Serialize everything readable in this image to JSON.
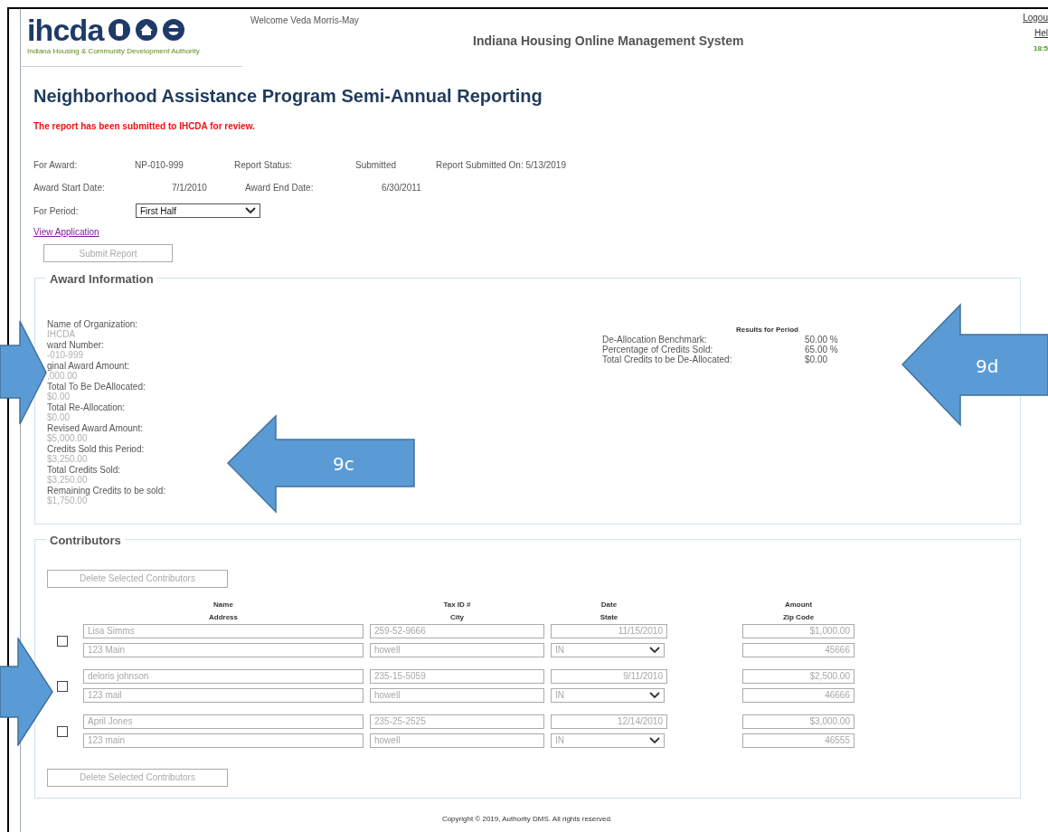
{
  "header": {
    "logo_text": "ihcda",
    "logo_tagline": "Indiana Housing & Community Development Authority",
    "welcome": "Welcome Veda Morris-May",
    "system_title": "Indiana Housing Online Management System",
    "links": [
      "Logou",
      "Hel"
    ],
    "time": "18:5"
  },
  "page_title": "Neighborhood Assistance Program Semi-Annual Reporting",
  "status_message": "The report has been submitted to IHCDA for review.",
  "summary_rows": [
    [
      "For Award:",
      "NP-010-999",
      "Report Status:",
      "Submitted",
      "Report Submitted On: 5/13/2019"
    ],
    [
      "Award Start Date:",
      "7/1/2010",
      "Award End Date:",
      "6/30/2011"
    ]
  ],
  "period": {
    "label": "For Period:",
    "value": "First Half"
  },
  "view_application_link": "View Application",
  "submit_button": {
    "label": "Submit Report",
    "disabled": true
  },
  "award_information": {
    "legend": "Award Information",
    "fields": [
      {
        "label": "Name of Organization:",
        "value": "IHCDA"
      },
      {
        "label": "ward Number:",
        "value": "-010-999"
      },
      {
        "label": "ginal Award Amount:",
        "value": ",000.00"
      },
      {
        "label": "Total To Be DeAllocated:",
        "value": "$0.00"
      },
      {
        "label": "Total Re-Allocation:",
        "value": "$0.00"
      },
      {
        "label": "Revised Award Amount:",
        "value": "$5,000.00"
      },
      {
        "label": "Credits Sold this Period:",
        "value": "$3,250.00"
      },
      {
        "label": "Total Credits Sold:",
        "value": "$3,250.00"
      },
      {
        "label": "Remaining Credits to be sold:",
        "value": "$1,750.00"
      }
    ],
    "results": {
      "title": "Results for Period",
      "rows": [
        {
          "label": "De-Allocation Benchmark:",
          "value": "50.00 %"
        },
        {
          "label": "Percentage of Credits Sold:",
          "value": "65.00 %"
        },
        {
          "label": "Total Credits to be De-Allocated:",
          "value": "$0.00"
        }
      ]
    }
  },
  "contributors": {
    "legend": "Contributors",
    "delete_buttons": [
      {
        "label": "Delete Selected Contributors",
        "disabled": true
      },
      {
        "label": "Delete Selected Contributors",
        "disabled": true
      }
    ],
    "columns": [
      {
        "top": "Name",
        "bottom": "Address"
      },
      {
        "top": "Tax ID #",
        "bottom": "City"
      },
      {
        "top": "Date",
        "bottom": "State"
      },
      {
        "top": "Amount",
        "bottom": "Zip Code"
      }
    ],
    "rows": [
      {
        "checked": false,
        "name": "Lisa Simms",
        "tax_id": "259-52-9666",
        "date": "11/15/2010",
        "amount": "$1,000.00",
        "address": "123 Main",
        "city": "howell",
        "state": "IN",
        "zip": "45666"
      },
      {
        "checked": false,
        "name": "deloris johnson",
        "tax_id": "235-15-5059",
        "date": "9/11/2010",
        "amount": "$2,500.00",
        "address": "123 mail",
        "city": "howell",
        "state": "IN",
        "zip": "46666"
      },
      {
        "checked": false,
        "name": "April Jones",
        "tax_id": "235-25-2525",
        "date": "12/14/2010",
        "amount": "$3,000.00",
        "address": "123 main",
        "city": "howell",
        "state": "IN",
        "zip": "46555"
      }
    ]
  },
  "footer": "Copyright © 2019, Authority DMS. All rights reserved.",
  "callouts": [
    {
      "kind": "arrow"
    },
    {
      "kind": "arrow",
      "label": "9c"
    },
    {
      "kind": "arrow",
      "label": "9d"
    },
    {
      "kind": "arrow"
    }
  ]
}
